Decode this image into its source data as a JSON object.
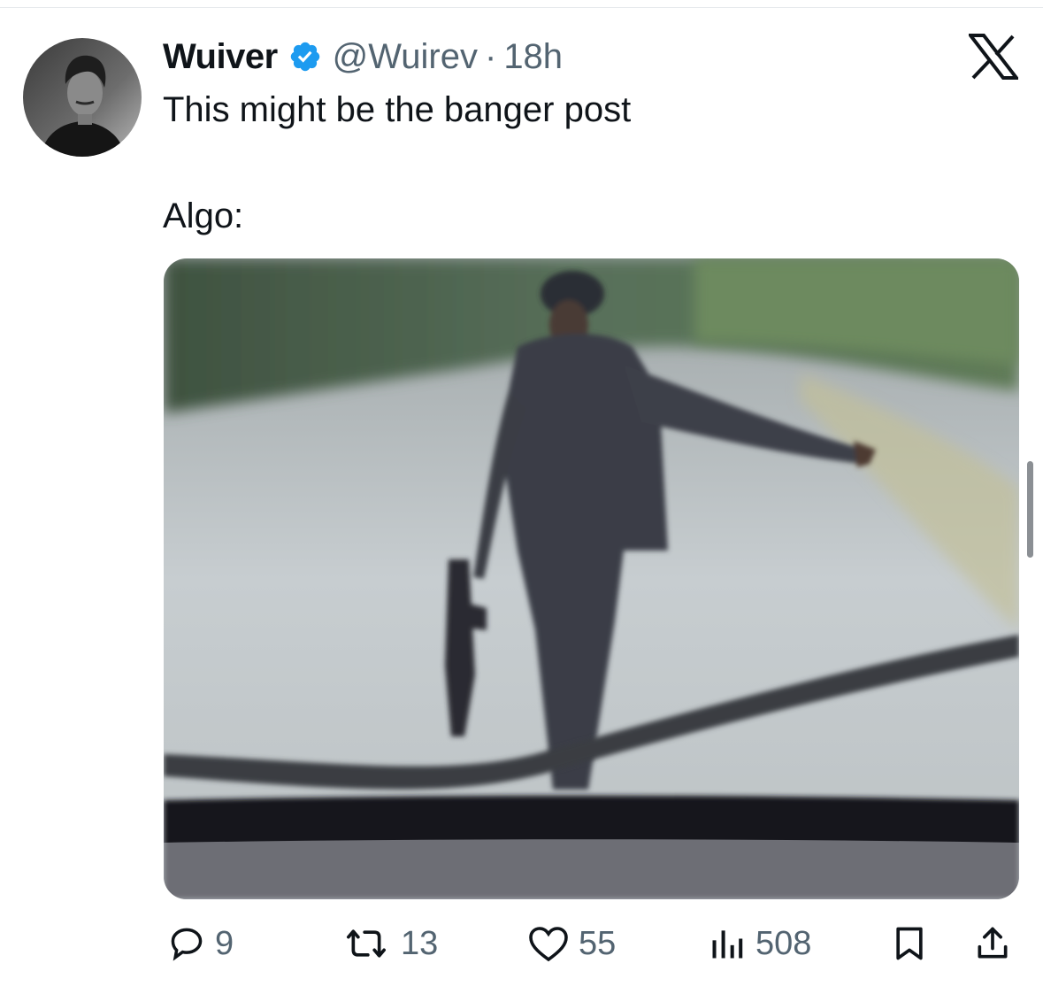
{
  "tweet": {
    "author_name": "Wuiver",
    "handle": "@Wuirev",
    "separator": "·",
    "time": "18h",
    "text_line1": "This might be the banger post",
    "text_line2": "Algo:"
  },
  "stats": {
    "replies": "9",
    "retweets": "13",
    "likes": "55",
    "views": "508"
  },
  "icons": {
    "verified": "verified-badge-icon",
    "platform": "x-logo-icon",
    "reply": "reply-icon",
    "retweet": "retweet-icon",
    "like": "heart-icon",
    "views": "views-icon",
    "bookmark": "bookmark-icon",
    "share": "share-icon"
  },
  "colors": {
    "verified": "#1d9bf0",
    "secondary_text": "#536471",
    "primary_text": "#0f1419"
  }
}
